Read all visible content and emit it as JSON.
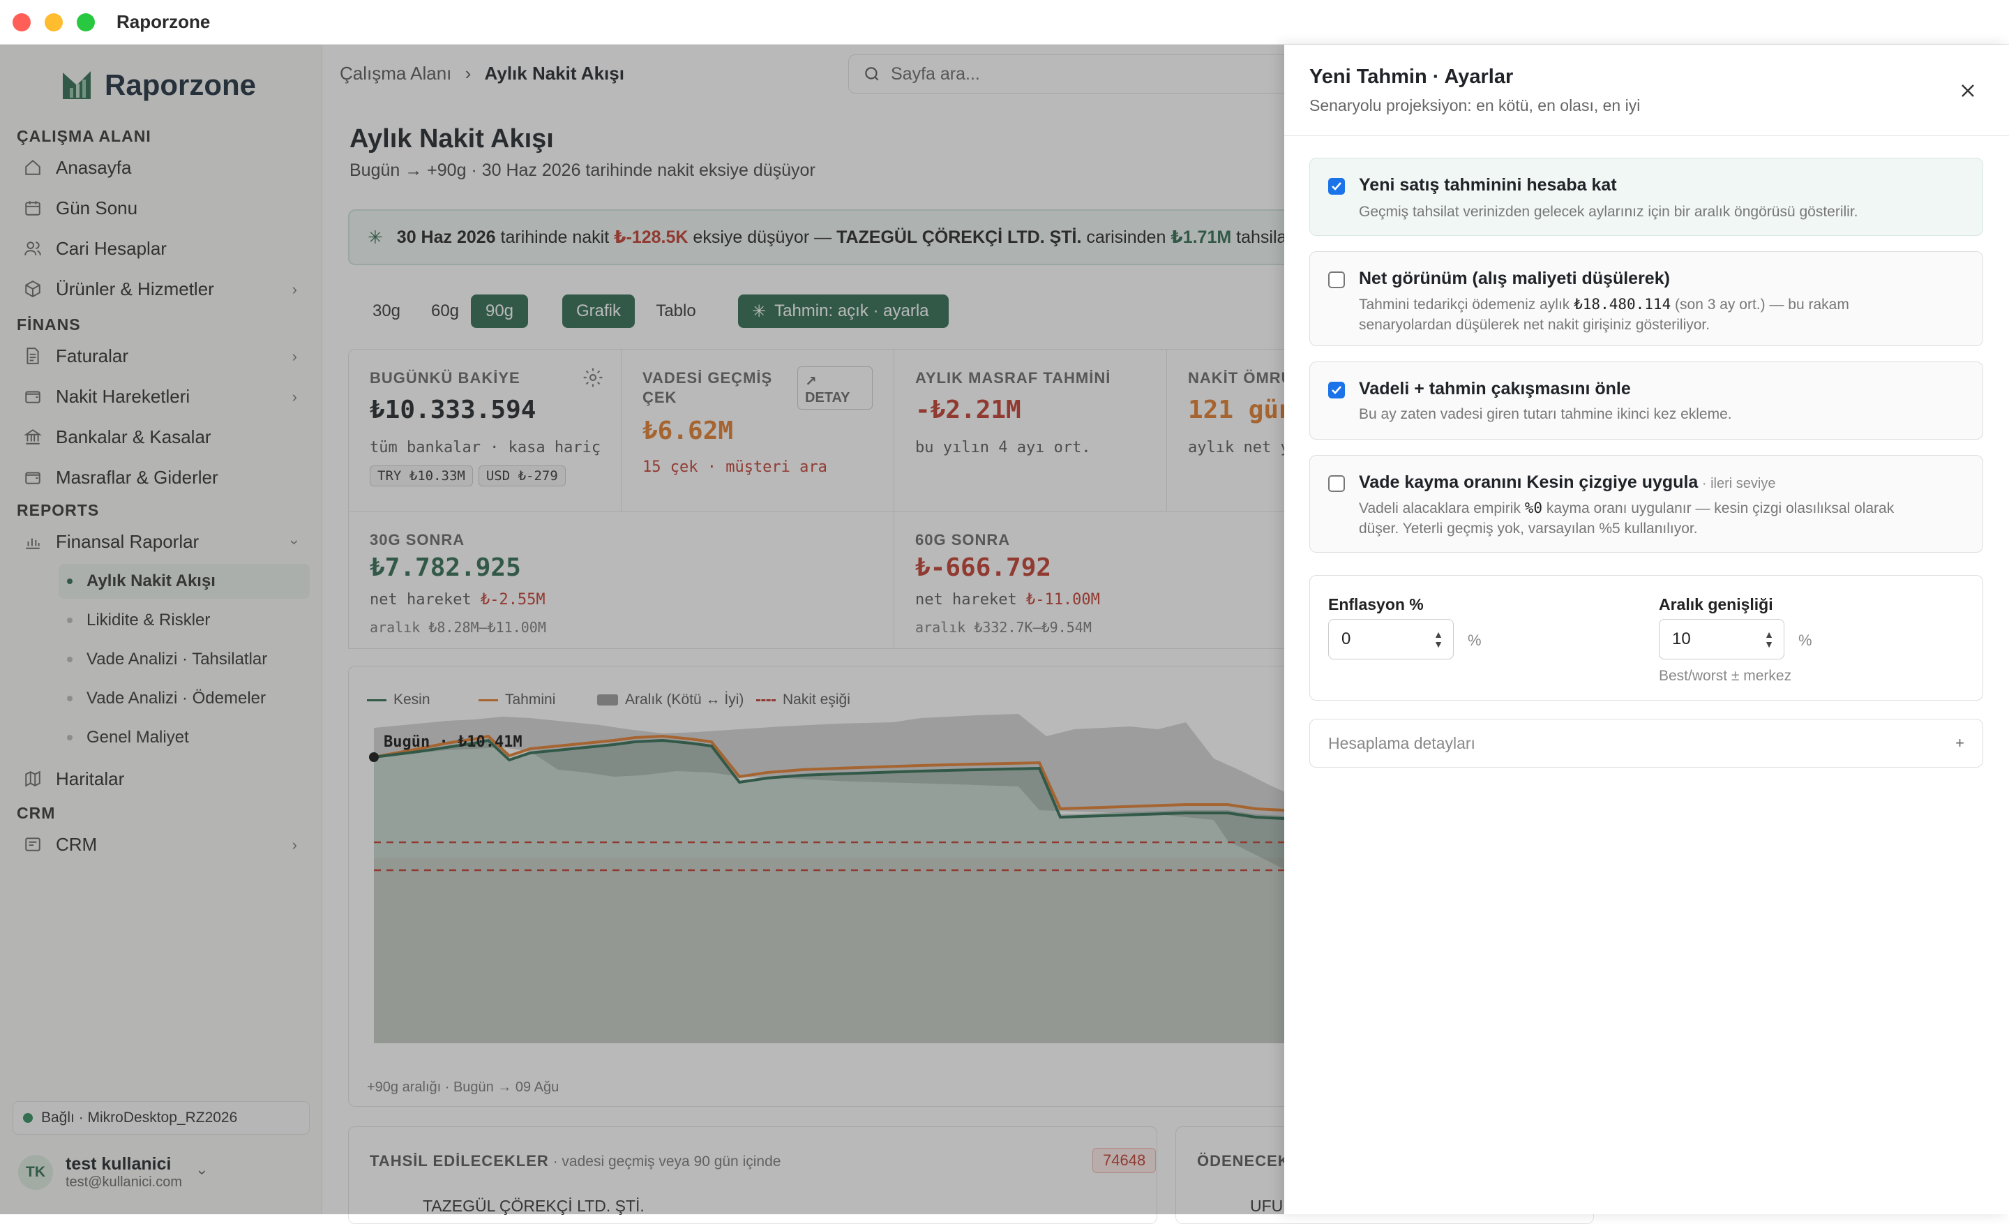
{
  "window": {
    "title": "Raporzone"
  },
  "sidebar": {
    "brand": "Raporzone",
    "sections": {
      "workspace": "ÇALIŞMA ALANI",
      "finance": "FİNANS",
      "reports": "REPORTS",
      "crm": "CRM"
    },
    "items": {
      "home": "Anasayfa",
      "day_end": "Gün Sonu",
      "accounts": "Cari Hesaplar",
      "products": "Ürünler & Hizmetler",
      "invoices": "Faturalar",
      "cash_moves": "Nakit Hareketleri",
      "banks": "Bankalar & Kasalar",
      "expenses": "Masraflar & Giderler",
      "fin_reports": "Finansal Raporlar",
      "maps": "Haritalar",
      "crm": "CRM"
    },
    "sub_items": [
      "Aylık Nakit Akışı",
      "Likidite & Riskler",
      "Vade Analizi · Tahsilatlar",
      "Vade Analizi · Ödemeler",
      "Genel Maliyet"
    ],
    "connection": "Bağlı · MikroDesktop_RZ2026",
    "user": {
      "initials": "TK",
      "name": "test kullanici",
      "email": "test@kullanici.com"
    }
  },
  "header": {
    "crumb_root": "Çalışma Alanı",
    "crumb_sep": "›",
    "crumb_current": "Aylık Nakit Akışı",
    "search_placeholder": "Sayfa ara..."
  },
  "page": {
    "title": "Aylık Nakit Akışı",
    "subtitle": "Bugün → +90g · 30 Haz 2026 tarihinde nakit eksiye düşüyor",
    "alert": {
      "date": "30 Haz 2026",
      "t1": " tarihinde nakit ",
      "amount": "₺-128.5K",
      "t2": " eksiye düşüyor — ",
      "company": "TAZEGÜL ÇÖREKÇİ LTD. ŞTİ.",
      "t3": " carisinden ",
      "amount2": "₺1.71M",
      "t4": " tahsila"
    },
    "ranges": [
      "30g",
      "60g",
      "90g"
    ],
    "views": [
      "Grafik",
      "Tablo"
    ],
    "forecast_btn": "Tahmin: açık · ayarla"
  },
  "cards": {
    "balance": {
      "label": "BUGÜNKÜ BAKİYE",
      "value": "₺10.333.594",
      "note": "tüm bankalar · kasa hariç",
      "chips": [
        "TRY ₺10.33M",
        "USD ₺-279"
      ]
    },
    "overdue": {
      "label1": "VADESİ GEÇMİŞ",
      "label2": "ÇEK",
      "value": "₺6.62M",
      "note": "15 çek · müşteri ara",
      "detail": "DETAY"
    },
    "expense": {
      "label": "AYLIK MASRAF TAHMİNİ",
      "value": "-₺2.21M",
      "note": "bu yılın 4 ayı ort."
    },
    "runway": {
      "label": "NAKİT ÖMRÜ",
      "value": "121 gün",
      "note": "aylık net y"
    },
    "d30": {
      "label": "30G SONRA",
      "value": "₺7.782.925",
      "net_label": "net hareket ",
      "net": "₺-2.55M",
      "range": "aralık ₺8.28M–₺11.00M"
    },
    "d60": {
      "label": "60G SONRA",
      "value": "₺-666.792",
      "net_label": "net hareket ",
      "net": "₺-11.00M",
      "range": "aralık ₺332.7K–₺9.54M"
    }
  },
  "chart": {
    "legend": [
      "Kesin",
      "Tahmini",
      "Aralık (Kötü ↔ İyi)",
      "Nakit eşiği"
    ],
    "today_label": "Bugün · ₺10.41M",
    "footer": "+90g aralığı · Bugün → 09 Ağu",
    "colors": {
      "kesin": "#2d6a4f",
      "tahmini": "#e07b2a",
      "range": "#8a8a8a",
      "threshold": "#c0392b"
    }
  },
  "chart_data": {
    "type": "area",
    "x": [
      "Bugün",
      "09 Ağu"
    ],
    "series": [
      {
        "name": "Kesin",
        "values": [
          10.41
        ]
      },
      {
        "name": "Tahmini",
        "values": [
          10.41
        ]
      }
    ],
    "ylabel": ""
  },
  "bottom": {
    "collect_title": "TAHSİL EDİLECEKLER",
    "collect_sub": " · vadesi geçmiş veya 90 gün içinde",
    "collect_badge": "74648",
    "row1": "TAZEGÜL ÇÖREKÇİ LTD. ŞTİ.",
    "pay_title": "ÖDENECEK",
    "row2": "UFU"
  },
  "panel": {
    "title": "Yeni Tahmin · Ayarlar",
    "subtitle": "Senaryolu projeksiyon: en kötü, en olası, en iyi",
    "options": [
      {
        "title": "Yeni satış tahminini hesaba kat",
        "desc": "Geçmiş tahsilat verinizden gelecek aylarınız için bir aralık öngörüsü gösterilir."
      },
      {
        "title": "Net görünüm (alış maliyeti düşülerek)",
        "desc_a": "Tahmini tedarikçi ödemeniz aylık ",
        "desc_amount": "₺18.480.114",
        "desc_b": " (son 3 ay ort.) — bu rakam",
        "desc_c": "senaryolardan düşülerek net nakit girişiniz gösteriliyor."
      },
      {
        "title": "Vadeli + tahmin çakışmasını önle",
        "desc": "Bu ay zaten vadesi giren tutarı tahmine ikinci kez ekleme."
      },
      {
        "title": "Vade kayma oranını Kesin çizgiye uygula",
        "tag": " · ileri seviye",
        "desc_a": "Vadeli alacaklara empirik ",
        "desc_pct": "%0",
        "desc_b": " kayma oranı uygulanır — kesin çizgi olasılıksal olarak",
        "desc_c": "düşer. Yeterli geçmiş yok, varsayılan %5 kullanılıyor."
      }
    ],
    "inflation": {
      "label": "Enflasyon %",
      "value": "0",
      "unit": "%"
    },
    "range_width": {
      "label": "Aralık genişliği",
      "value": "10",
      "unit": "%",
      "hint": "Best/worst ± merkez"
    },
    "details": "Hesaplama detayları",
    "details_icon": "+"
  }
}
